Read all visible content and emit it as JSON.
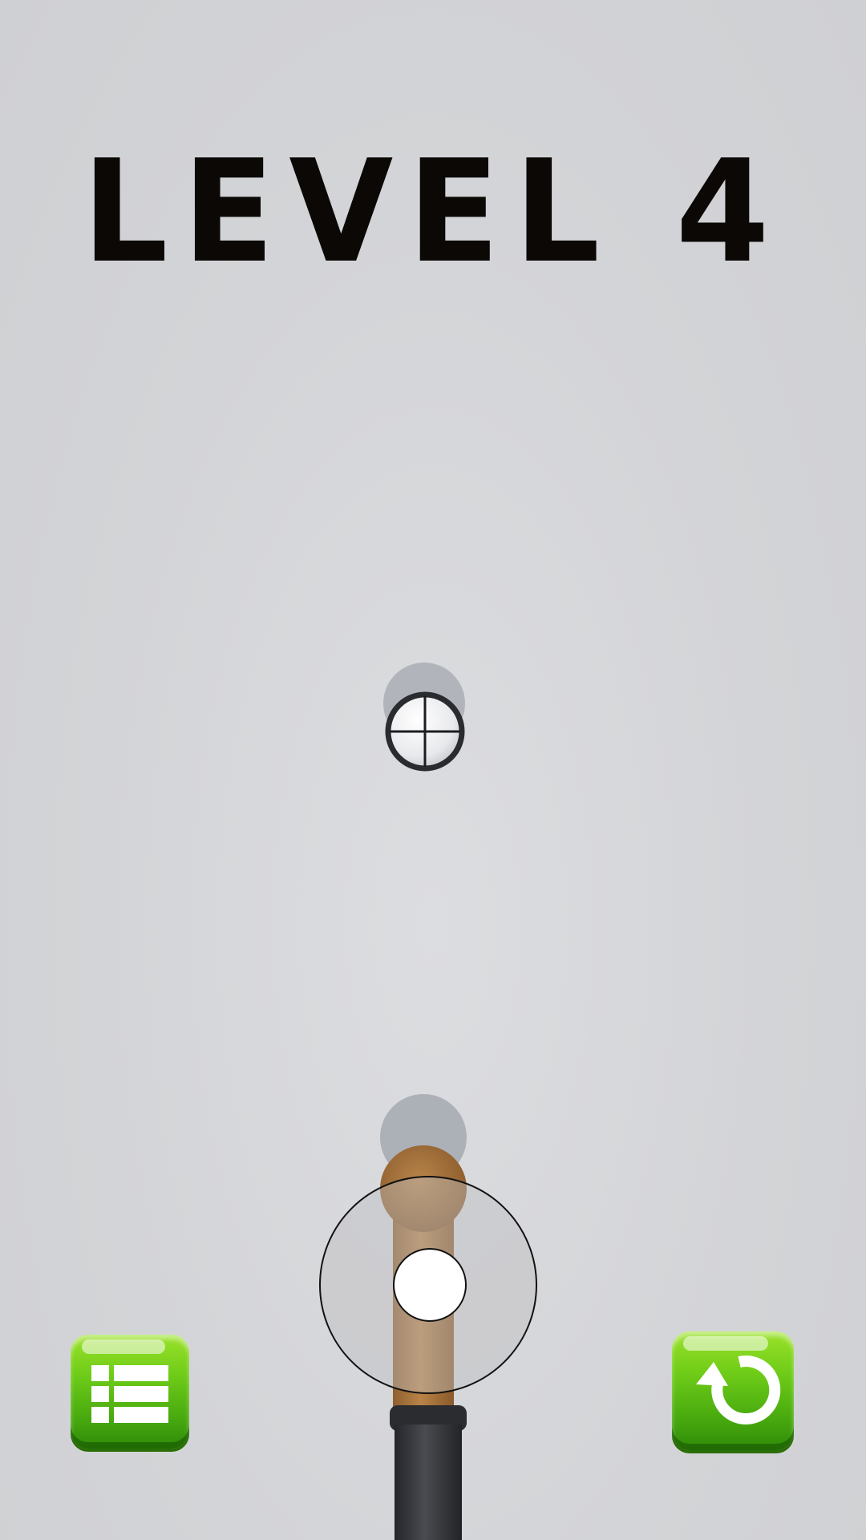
{
  "level": {
    "title": "LEVEL 4"
  },
  "buttons": {
    "menu_icon": "list-icon",
    "restart_icon": "restart-icon"
  },
  "colors": {
    "button_green": "#6fcc18",
    "bat_wood": "#a9743c",
    "bat_grip": "#2f3034",
    "background": "#d3d4d7"
  }
}
